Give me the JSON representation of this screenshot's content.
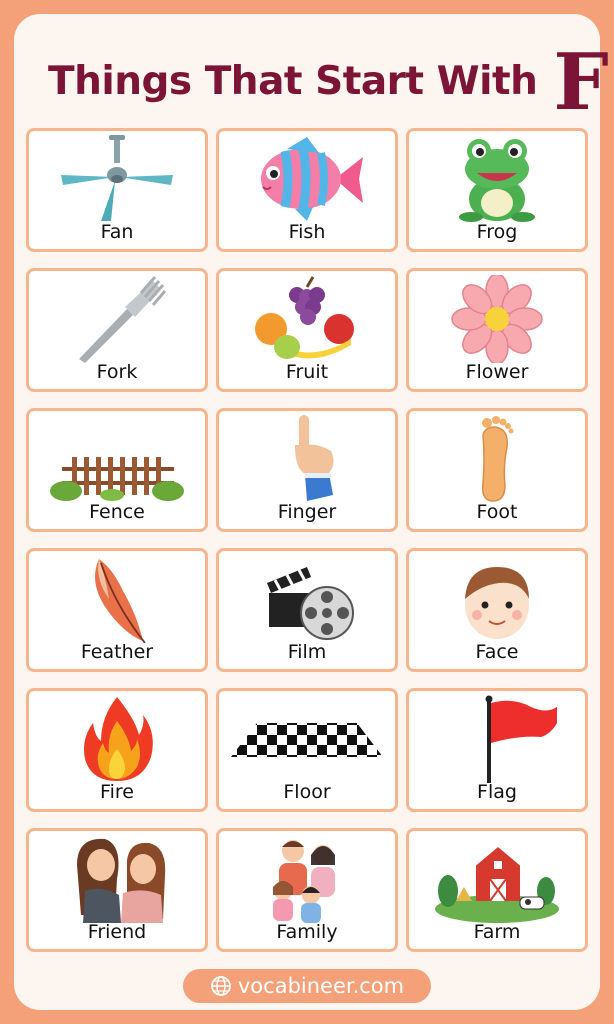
{
  "header": {
    "title": "Things That Start With",
    "letter": "F"
  },
  "items": [
    {
      "label": "Fan"
    },
    {
      "label": "Fish"
    },
    {
      "label": "Frog"
    },
    {
      "label": "Fork"
    },
    {
      "label": "Fruit"
    },
    {
      "label": "Flower"
    },
    {
      "label": "Fence"
    },
    {
      "label": "Finger"
    },
    {
      "label": "Foot"
    },
    {
      "label": "Feather"
    },
    {
      "label": "Film"
    },
    {
      "label": "Face"
    },
    {
      "label": "Fire"
    },
    {
      "label": "Floor"
    },
    {
      "label": "Flag"
    },
    {
      "label": "Friend"
    },
    {
      "label": "Family"
    },
    {
      "label": "Farm"
    }
  ],
  "footer": {
    "site": "vocabineer.com"
  },
  "colors": {
    "background": "#f4a078",
    "title": "#7b1436",
    "cell_border": "#f6b58d"
  }
}
